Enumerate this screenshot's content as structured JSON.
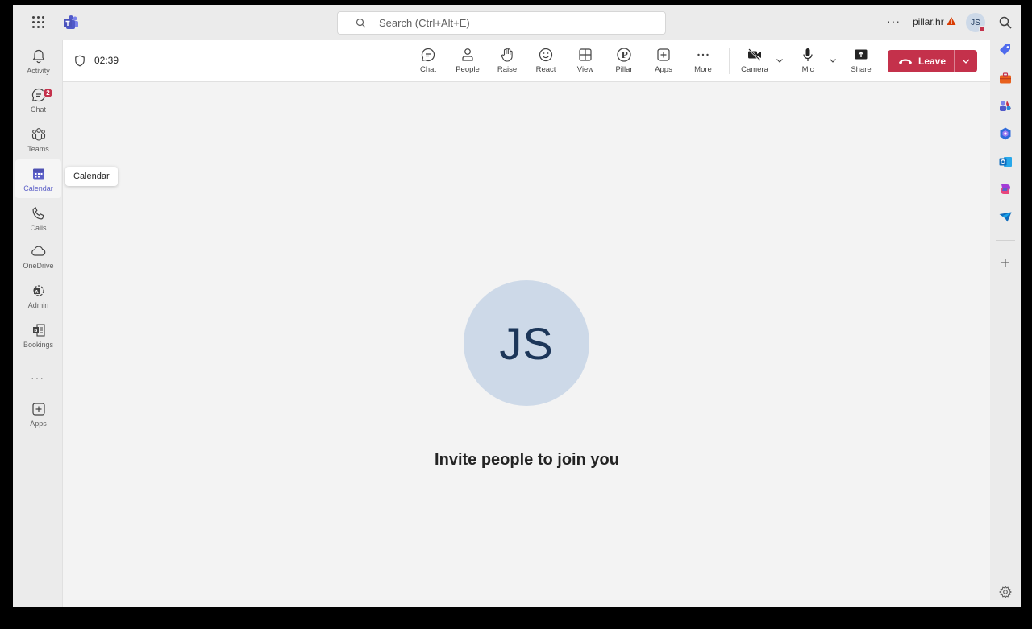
{
  "titlebar": {
    "search_placeholder": "Search (Ctrl+Alt+E)",
    "more_label": "···",
    "org_name": "pillar.hr",
    "user_initials": "JS"
  },
  "rail": {
    "items": [
      {
        "label": "Activity",
        "icon": "bell-icon"
      },
      {
        "label": "Chat",
        "icon": "chat-icon",
        "badge": "2"
      },
      {
        "label": "Teams",
        "icon": "teams-icon"
      },
      {
        "label": "Calendar",
        "icon": "calendar-icon",
        "active": true
      },
      {
        "label": "Calls",
        "icon": "phone-icon"
      },
      {
        "label": "OneDrive",
        "icon": "cloud-icon"
      },
      {
        "label": "Admin",
        "icon": "admin-icon"
      },
      {
        "label": "Bookings",
        "icon": "bookings-icon"
      },
      {
        "label": "Apps",
        "icon": "add-apps-icon"
      }
    ],
    "more_label": "···",
    "tooltip": "Calendar"
  },
  "meeting": {
    "timer": "02:39",
    "toolbar": {
      "chat": "Chat",
      "people": "People",
      "raise": "Raise",
      "react": "React",
      "view": "View",
      "pillar": "Pillar",
      "apps": "Apps",
      "more": "More",
      "camera": "Camera",
      "mic": "Mic",
      "share": "Share",
      "leave": "Leave"
    },
    "participant_initials": "JS",
    "invite_text": "Invite people to join you"
  },
  "colors": {
    "accent": "#5b5fc7",
    "leave": "#c4314b",
    "avatar_bg": "#cdd9e8",
    "avatar_text": "#1c3659"
  }
}
